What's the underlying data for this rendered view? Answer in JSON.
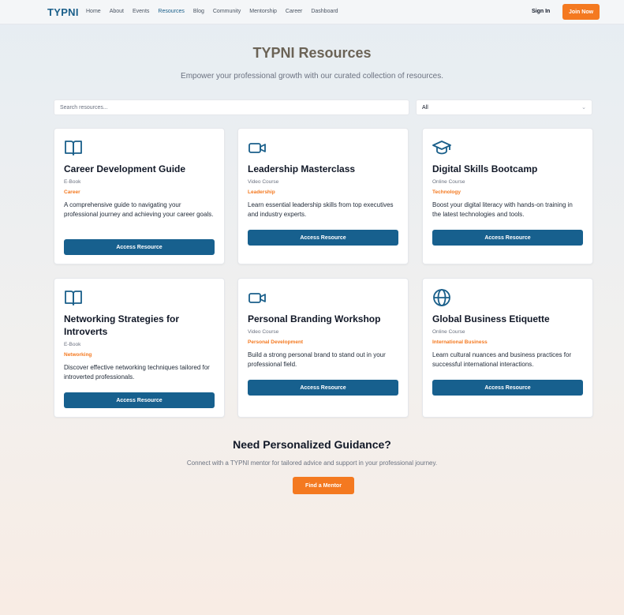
{
  "nav": {
    "logo": "TYPNI",
    "links": [
      "Home",
      "About",
      "Events",
      "Resources",
      "Blog",
      "Community",
      "Mentorship",
      "Career",
      "Dashboard"
    ],
    "active_link": "Resources",
    "signin": "Sign In",
    "join": "Join Now"
  },
  "header": {
    "title": "TYPNI Resources",
    "subtitle": "Empower your professional growth with our curated collection of resources."
  },
  "search": {
    "placeholder": "Search resources..."
  },
  "filter": {
    "selected": "All"
  },
  "cards": [
    {
      "icon": "book-open-icon",
      "title": "Career Development Guide",
      "type": "E-Book",
      "category": "Career",
      "description": "A comprehensive guide to navigating your professional journey and achieving your career goals.",
      "button": "Access Resource"
    },
    {
      "icon": "video-icon",
      "title": "Leadership Masterclass",
      "type": "Video Course",
      "category": "Leadership",
      "description": "Learn essential leadership skills from top executives and industry experts.",
      "button": "Access Resource"
    },
    {
      "icon": "graduation-cap-icon",
      "title": "Digital Skills Bootcamp",
      "type": "Online Course",
      "category": "Technology",
      "description": "Boost your digital literacy with hands-on training in the latest technologies and tools.",
      "button": "Access Resource"
    },
    {
      "icon": "book-open-icon",
      "title": "Networking Strategies for Introverts",
      "type": "E-Book",
      "category": "Networking",
      "description": "Discover effective networking techniques tailored for introverted professionals.",
      "button": "Access Resource"
    },
    {
      "icon": "video-icon",
      "title": "Personal Branding Workshop",
      "type": "Video Course",
      "category": "Personal Development",
      "description": "Build a strong personal brand to stand out in your professional field.",
      "button": "Access Resource"
    },
    {
      "icon": "globe-icon",
      "title": "Global Business Etiquette",
      "type": "Online Course",
      "category": "International Business",
      "description": "Learn cultural nuances and business practices for successful international interactions.",
      "button": "Access Resource"
    }
  ],
  "guidance": {
    "title": "Need Personalized Guidance?",
    "subtitle": "Connect with a TYPNI mentor for tailored advice and support in your professional journey.",
    "button": "Find a Mentor"
  },
  "colors": {
    "brand": "#1a5f8a",
    "accent": "#f47920",
    "button": "#17608e"
  }
}
